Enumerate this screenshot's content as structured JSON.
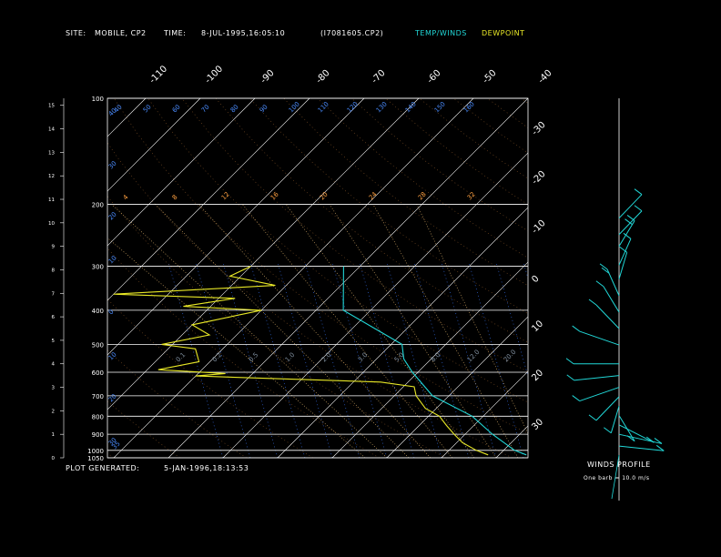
{
  "header": {
    "site_label": "SITE:",
    "site_value": "MOBILE, CP2",
    "time_label": "TIME:",
    "time_value": "8-JUL-1995,16:05:10",
    "file": "(I7081605.CP2)",
    "temp_winds": "TEMP/WINDS",
    "dewpoint": "DEWPOINT"
  },
  "footer": {
    "generated_label": "PLOT GENERATED:",
    "generated_value": "5-JAN-1996,18:13:53",
    "winds_profile": "WINDS PROFILE",
    "barb_note": "One barb = 10.0 m/s"
  },
  "colors": {
    "background": "#000000",
    "frame": "#ffffff",
    "isobar": "#ffffff",
    "isotherm": "#ffffff",
    "dry_adiabat": "#6d4520",
    "moist_adiabat": "#c8a060",
    "mixing_ratio": "#3a78ff",
    "temperature": "#21d7d7",
    "dewpoint": "#e8e826",
    "wind": "#21d7d7",
    "dry_label": "#4a8cff",
    "moist_label": "#ffa040"
  },
  "chart_data": {
    "type": "line",
    "title": "",
    "pressure_levels": [
      "100",
      "200",
      "300",
      "400",
      "500",
      "600",
      "700",
      "800",
      "900",
      "1000",
      "1050"
    ],
    "height_ticks": [
      "0",
      "1",
      "2",
      "3",
      "4",
      "5",
      "6",
      "7",
      "8",
      "9",
      "10",
      "11",
      "12",
      "13",
      "14",
      "15"
    ],
    "top_temperature_labels": [
      "-110",
      "-100",
      "-90",
      "-80",
      "-70",
      "-60",
      "-50",
      "-40"
    ],
    "right_temperature_labels": [
      "-30",
      "-20",
      "-10",
      "0",
      "10",
      "20",
      "30"
    ],
    "dry_adiabat_labels": [
      "40",
      "50",
      "60",
      "70",
      "80",
      "90",
      "100",
      "110",
      "120",
      "130",
      "140",
      "150",
      "160"
    ],
    "moist_adiabat_labels": [
      "4",
      "8",
      "12",
      "16",
      "20",
      "24",
      "28",
      "32"
    ],
    "left_mixing_labels": [
      "40",
      "30",
      "20",
      "10",
      "0",
      "10",
      "20",
      "30",
      "35"
    ],
    "mixing_ratio_labels": [
      "0.1",
      "0.2",
      "0.5",
      "1.0",
      "2.0",
      "3.0",
      "5.0",
      "8.0",
      "12.0",
      "20.0"
    ],
    "temperature_C_range": [
      -110,
      40
    ],
    "pressure_hPa_range": [
      100,
      1050
    ],
    "temperature_profile": {
      "name": "TEMP/WINDS",
      "points": [
        [
          -43,
          300
        ],
        [
          -35,
          400
        ],
        [
          -18,
          500
        ],
        [
          -15,
          550
        ],
        [
          -11,
          600
        ],
        [
          -3,
          700
        ],
        [
          8,
          800
        ],
        [
          15,
          900
        ],
        [
          22,
          1000
        ],
        [
          25,
          1030
        ]
      ]
    },
    "dewpoint_profile": {
      "name": "DEWPOINT",
      "points": [
        [
          -60,
          300
        ],
        [
          -62,
          320
        ],
        [
          -52,
          340
        ],
        [
          -80,
          360
        ],
        [
          -57,
          370
        ],
        [
          -65,
          390
        ],
        [
          -50,
          400
        ],
        [
          -60,
          440
        ],
        [
          -55,
          470
        ],
        [
          -62,
          500
        ],
        [
          -55,
          515
        ],
        [
          -52,
          560
        ],
        [
          -58,
          590
        ],
        [
          -45,
          605
        ],
        [
          -50,
          615
        ],
        [
          -15,
          640
        ],
        [
          -8,
          660
        ],
        [
          -6,
          700
        ],
        [
          -2,
          760
        ],
        [
          2,
          800
        ],
        [
          5,
          850
        ],
        [
          8,
          900
        ],
        [
          11,
          950
        ],
        [
          15,
          1000
        ],
        [
          18,
          1030
        ]
      ]
    },
    "wind_profile": [
      {
        "height_km": 10.2,
        "dir": 330,
        "speed_ms": 10
      },
      {
        "height_km": 9.5,
        "dir": 330,
        "speed_ms": 10
      },
      {
        "height_km": 9.0,
        "dir": 340,
        "speed_ms": 15
      },
      {
        "height_km": 8.2,
        "dir": 345,
        "speed_ms": 10
      },
      {
        "height_km": 7.6,
        "dir": 350,
        "speed_ms": 10
      },
      {
        "height_km": 6.9,
        "dir": 15,
        "speed_ms": 20
      },
      {
        "height_km": 6.2,
        "dir": 20,
        "speed_ms": 10
      },
      {
        "height_km": 5.5,
        "dir": 30,
        "speed_ms": 10
      },
      {
        "height_km": 4.8,
        "dir": 60,
        "speed_ms": 10
      },
      {
        "height_km": 4.0,
        "dir": 90,
        "speed_ms": 10
      },
      {
        "height_km": 3.5,
        "dir": 100,
        "speed_ms": 10
      },
      {
        "height_km": 3.0,
        "dir": 120,
        "speed_ms": 10
      },
      {
        "height_km": 2.6,
        "dir": 150,
        "speed_ms": 10
      },
      {
        "height_km": 2.2,
        "dir": 170,
        "speed_ms": 10
      },
      {
        "height_km": 1.8,
        "dir": 200,
        "speed_ms": 10
      },
      {
        "height_km": 1.4,
        "dir": 230,
        "speed_ms": 10
      },
      {
        "height_km": 1.0,
        "dir": 250,
        "speed_ms": 10
      },
      {
        "height_km": 0.5,
        "dir": 260,
        "speed_ms": 5
      }
    ]
  }
}
